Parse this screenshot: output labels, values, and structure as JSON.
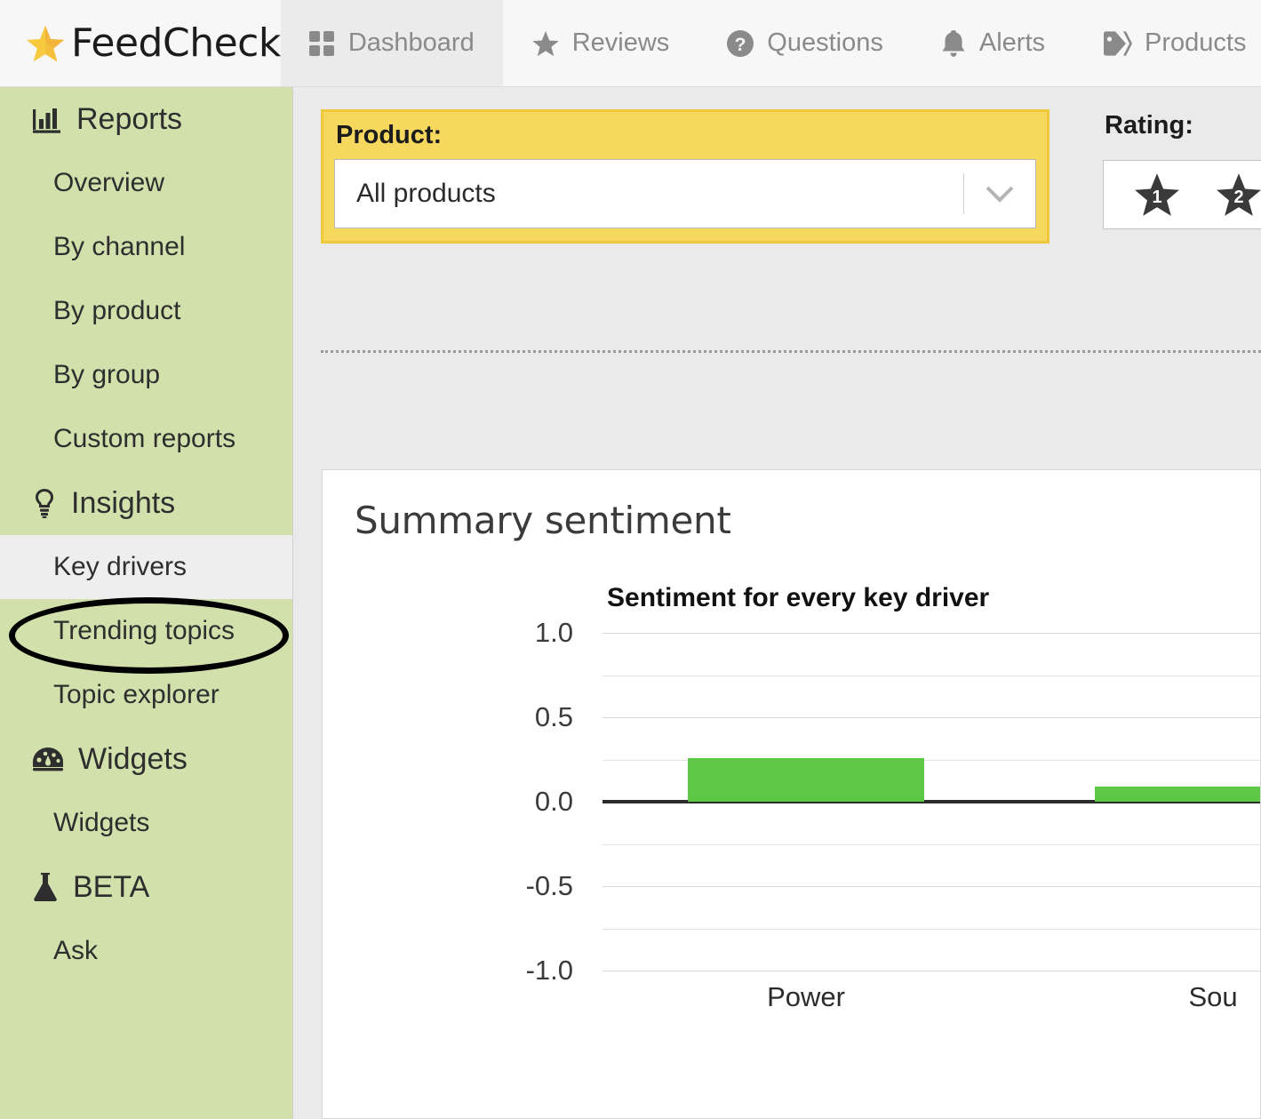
{
  "brand": {
    "name": "FeedCheck",
    "logo_icon": "star-icon"
  },
  "topnav": {
    "items": [
      {
        "label": "Dashboard",
        "icon": "grid-icon",
        "active": true
      },
      {
        "label": "Reviews",
        "icon": "star-icon",
        "active": false
      },
      {
        "label": "Questions",
        "icon": "question-circle-icon",
        "active": false
      },
      {
        "label": "Alerts",
        "icon": "bell-icon",
        "active": false
      },
      {
        "label": "Products",
        "icon": "tag-icon",
        "active": false
      }
    ]
  },
  "sidebar": {
    "groups": [
      {
        "label": "Reports",
        "icon": "bar-chart-icon",
        "items": [
          {
            "label": "Overview",
            "selected": false
          },
          {
            "label": "By channel",
            "selected": false
          },
          {
            "label": "By product",
            "selected": false
          },
          {
            "label": "By group",
            "selected": false
          },
          {
            "label": "Custom reports",
            "selected": false
          }
        ]
      },
      {
        "label": "Insights",
        "icon": "lightbulb-icon",
        "items": [
          {
            "label": "Key drivers",
            "selected": true
          },
          {
            "label": "Trending topics",
            "selected": false
          },
          {
            "label": "Topic explorer",
            "selected": false
          }
        ]
      },
      {
        "label": "Widgets",
        "icon": "gauge-icon",
        "items": [
          {
            "label": "Widgets",
            "selected": false
          }
        ]
      },
      {
        "label": "BETA",
        "icon": "flask-icon",
        "items": [
          {
            "label": "Ask",
            "selected": false
          }
        ]
      }
    ]
  },
  "filters": {
    "product": {
      "label": "Product:",
      "value": "All products",
      "placeholder": "All products",
      "caret_icon": "chevron-down-icon",
      "highlight_color": "#f7d85f"
    },
    "rating": {
      "label": "Rating:",
      "stars": [
        "1",
        "2"
      ],
      "star_icon": "star-icon"
    }
  },
  "card": {
    "title": "Summary sentiment"
  },
  "chart_data": {
    "type": "bar",
    "title": "Sentiment for every key driver",
    "xlabel": "",
    "ylabel": "",
    "categories": [
      "Power",
      "Sou"
    ],
    "values": [
      0.26,
      0.09
    ],
    "ylim": [
      -1.0,
      1.0
    ],
    "yticks": [
      1.0,
      0.5,
      0.0,
      -0.5,
      -1.0
    ],
    "ytick_labels": [
      "1.0",
      "0.5",
      "0.0",
      "-0.5",
      "-1.0"
    ],
    "minor_gridlines": [
      0.75,
      0.25,
      -0.25,
      -0.75
    ],
    "grid": true,
    "legend": "none",
    "bar_color": "#5cc846",
    "zero_line_color": "#2c2c2c"
  }
}
